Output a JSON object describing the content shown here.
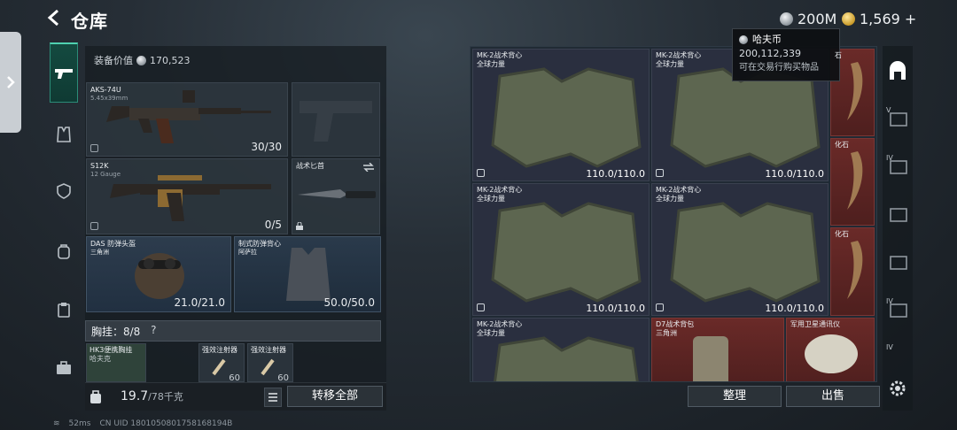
{
  "header": {
    "back_icon": "arrow-left-icon",
    "title": "仓库"
  },
  "currency": {
    "silver_amount": "200M",
    "gold_amount": "1,569",
    "gold_plus": "+"
  },
  "tooltip": {
    "name": "哈夫币",
    "amount": "200,112,339",
    "desc": "可在交易行购买物品"
  },
  "equipment": {
    "value_label": "装备价值",
    "value": "170,523",
    "weapon1": {
      "name": "AKS-74U",
      "ammo": "5.45x39mm",
      "count": "30/30"
    },
    "weapon2": {
      "name": "S12K",
      "ammo": "12 Gauge",
      "count": "0/5"
    },
    "melee": {
      "name": "战术匕首"
    },
    "helmet": {
      "name": "DAS 防弹头盔",
      "map": "三角洲",
      "durability": "21.0/21.0"
    },
    "armor": {
      "name": "制式防弹背心",
      "map": "阿萨拉",
      "durability": "50.0/50.0"
    },
    "chest_rig_label": "胸挂：8/8",
    "chest_rig_help": "?",
    "rig_item": {
      "name": "HK3便携胸挂",
      "map": "哈夫克"
    },
    "injector1": {
      "name": "强效注射器",
      "count": "60"
    },
    "injector2": {
      "name": "强效注射器",
      "count": "60"
    },
    "weight": "19.7",
    "weight_max": "/78千克",
    "transfer_all": "转移全部"
  },
  "stash": {
    "items": [
      {
        "name": "MK-2战术背心",
        "map": "全球力量",
        "durability": "110.0/110.0"
      },
      {
        "name": "MK-2战术背心",
        "map": "全球力量",
        "durability": "110.0/110.0"
      },
      {
        "name": "MK-2战术背心",
        "map": "全球力量",
        "durability": "110.0/110.0"
      },
      {
        "name": "MK-2战术背心",
        "map": "全球力量",
        "durability": "110.0/110.0"
      },
      {
        "name": "MK-2战术背心",
        "map": "全球力量"
      },
      {
        "name": "D7战术背包",
        "map": "三角洲"
      },
      {
        "name": "军用卫星通讯仪"
      }
    ],
    "fossils": [
      "石",
      "化石",
      "化石"
    ],
    "sort": "整理",
    "sell": "出售"
  },
  "sidebar_right": {
    "tab_labels": [
      "V",
      "IV",
      "IV",
      "IV"
    ]
  },
  "status": {
    "ping": "52ms",
    "uid": "CN UID 1801050801758168194B"
  },
  "colors": {
    "accent": "#4fd1b1",
    "red_item": "#6a2a28",
    "blue_item": "#2d3c4d"
  }
}
